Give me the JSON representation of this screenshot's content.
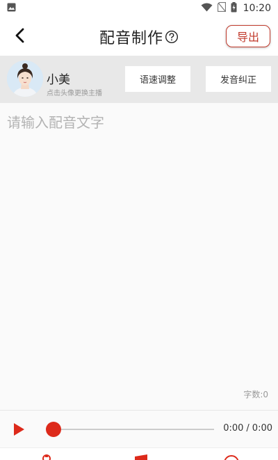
{
  "status_bar": {
    "time": "10:20",
    "icons": [
      "image-notification-icon",
      "wifi-icon",
      "no-sim-icon",
      "battery-charging-icon"
    ]
  },
  "header": {
    "title": "配音制作",
    "export_label": "导出",
    "icons": [
      "back-arrow-icon",
      "help-circle-icon"
    ]
  },
  "speaker": {
    "name": "小美",
    "hint": "点击头像更换主播",
    "speed_label": "语速调整",
    "pronunciation_label": "发音纠正"
  },
  "editor": {
    "placeholder": "请输入配音文字",
    "value": "",
    "word_count_label": "字数:",
    "word_count": "0"
  },
  "player": {
    "current_time": "0:00",
    "separator": "/",
    "total_time": "0:00",
    "progress": 0,
    "icons": [
      "play-icon"
    ]
  },
  "colors": {
    "accent": "#dd2a1b",
    "export_border": "#c0392b",
    "speaker_bg": "#e8e8e8",
    "page_bg": "#fafafa"
  }
}
